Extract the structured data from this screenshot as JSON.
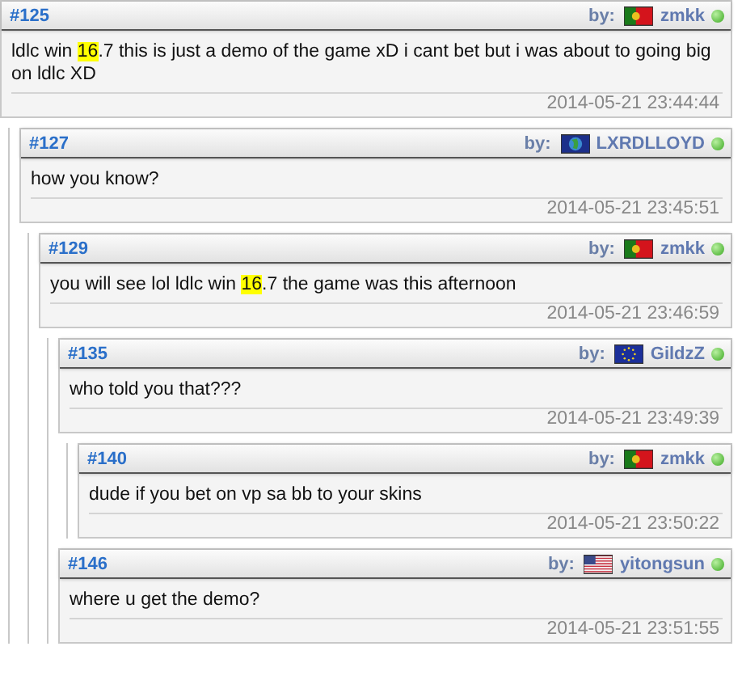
{
  "comments": [
    {
      "number": "#125",
      "by_label": "by:",
      "flag": {
        "kind": "portugal"
      },
      "author": "zmkk",
      "online": true,
      "segments": [
        {
          "text": "ldlc win ",
          "highlighted": false
        },
        {
          "text": "16",
          "highlighted": true
        },
        {
          "text": ".7 this is just a demo of the game xD i cant bet but i was about to going big on ldlc XD",
          "highlighted": false
        }
      ],
      "timestamp": "2014-05-21 23:44:44",
      "children": [
        {
          "number": "#127",
          "by_label": "by:",
          "flag": {
            "kind": "globe"
          },
          "author": "LXRDLLOYD",
          "online": true,
          "segments": [
            {
              "text": "how you know?",
              "highlighted": false
            }
          ],
          "timestamp": "2014-05-21 23:45:51",
          "children": [
            {
              "number": "#129",
              "by_label": "by:",
              "flag": {
                "kind": "portugal"
              },
              "author": "zmkk",
              "online": true,
              "segments": [
                {
                  "text": "you will see lol ldlc win ",
                  "highlighted": false
                },
                {
                  "text": "16",
                  "highlighted": true
                },
                {
                  "text": ".7 the game was this afternoon",
                  "highlighted": false
                }
              ],
              "timestamp": "2014-05-21 23:46:59",
              "children": [
                {
                  "number": "#135",
                  "by_label": "by:",
                  "flag": {
                    "kind": "eu"
                  },
                  "author": "GildzZ",
                  "online": true,
                  "segments": [
                    {
                      "text": "who told you that???",
                      "highlighted": false
                    }
                  ],
                  "timestamp": "2014-05-21 23:49:39",
                  "children": [
                    {
                      "number": "#140",
                      "by_label": "by:",
                      "flag": {
                        "kind": "portugal"
                      },
                      "author": "zmkk",
                      "online": true,
                      "segments": [
                        {
                          "text": "dude if you bet on vp sa bb to your skins",
                          "highlighted": false
                        }
                      ],
                      "timestamp": "2014-05-21 23:50:22"
                    }
                  ]
                },
                {
                  "number": "#146",
                  "by_label": "by:",
                  "flag": {
                    "kind": "usa"
                  },
                  "author": "yitongsun",
                  "online": true,
                  "segments": [
                    {
                      "text": "where u get the demo?",
                      "highlighted": false
                    }
                  ],
                  "timestamp": "2014-05-21 23:51:55"
                }
              ]
            }
          ]
        }
      ]
    }
  ]
}
